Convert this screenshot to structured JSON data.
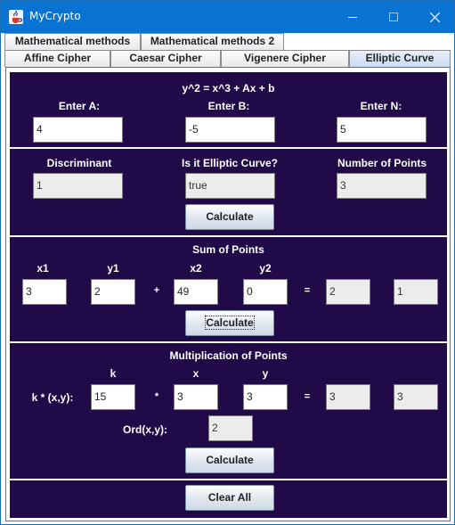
{
  "window": {
    "title": "MyCrypto"
  },
  "tabs_row1": [
    {
      "label": "Mathematical methods"
    },
    {
      "label": "Mathematical methods 2"
    }
  ],
  "tabs_row2": [
    {
      "label": "Affine Cipher"
    },
    {
      "label": "Caesar Cipher"
    },
    {
      "label": "Vigenere Cipher"
    },
    {
      "label": "Elliptic Curve",
      "selected": true
    }
  ],
  "curve": {
    "equation": "y^2 = x^3 + Ax + b",
    "a_label": "Enter A:",
    "b_label": "Enter B:",
    "n_label": "Enter N:",
    "a_value": "4",
    "b_value": "-5",
    "n_value": "5",
    "discriminant_label": "Discriminant",
    "is_curve_label": "Is it Elliptic Curve?",
    "num_points_label": "Number of Points",
    "discriminant_value": "1",
    "is_curve_value": "true",
    "num_points_value": "3",
    "calculate_label": "Calculate"
  },
  "sum": {
    "title": "Sum of Points",
    "x1_label": "x1",
    "y1_label": "y1",
    "x2_label": "x2",
    "y2_label": "y2",
    "plus_sign": "+",
    "equals_sign": "=",
    "x1_value": "3",
    "y1_value": "2",
    "x2_value": "49",
    "y2_value": "0",
    "result_x": "2",
    "result_y": "1",
    "calculate_label": "Calculate"
  },
  "mult": {
    "title": "Multiplication of Points",
    "k_label": "k",
    "x_label": "x",
    "y_label": "y",
    "row_label": "k * (x,y):",
    "times_sign": "*",
    "equals_sign": "=",
    "k_value": "15",
    "x_value": "3",
    "y_value": "3",
    "result_x": "3",
    "result_y": "3",
    "ord_label": "Ord(x,y):",
    "ord_value": "2",
    "calculate_label": "Calculate"
  },
  "clear_label": "Clear All",
  "colors": {
    "titlebar": "#0a73d2",
    "panel_bg": "#200b48",
    "active_tab": "#c9dcf2"
  },
  "icons": {
    "app": "java-cup-icon",
    "minimize": "minimize-icon",
    "maximize": "maximize-icon",
    "close": "close-icon"
  }
}
